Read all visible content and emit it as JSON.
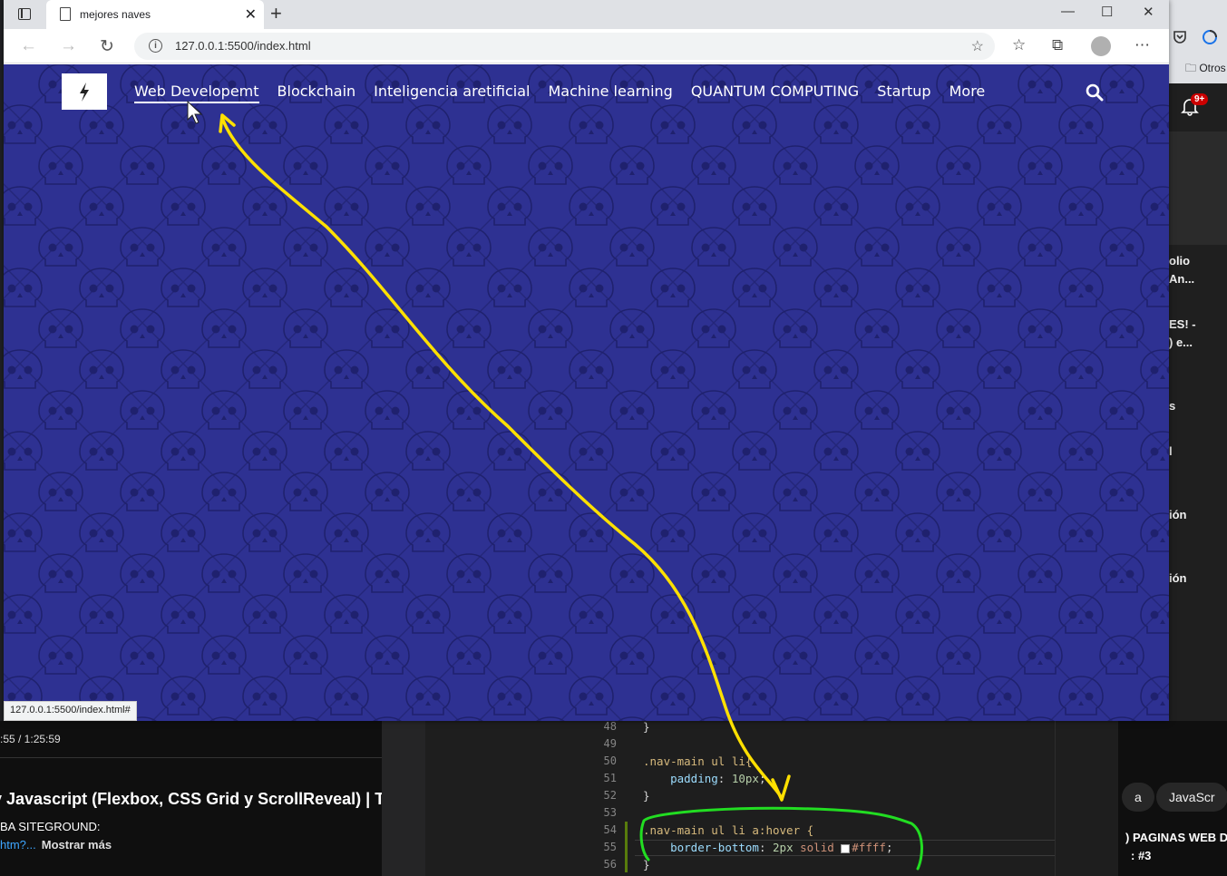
{
  "browser": {
    "tab_title": "mejores naves",
    "url": "127.0.0.1:5500/index.html",
    "status_url": "127.0.0.1:5500/index.html#"
  },
  "site": {
    "nav": [
      {
        "label": "Web Developemt",
        "active": true
      },
      {
        "label": "Blockchain"
      },
      {
        "label": "Inteligencia aretificial"
      },
      {
        "label": "Machine learning"
      },
      {
        "label": "QUANTUM COMPUTING"
      },
      {
        "label": "Startup"
      },
      {
        "label": "More"
      }
    ],
    "background": "#2e3192",
    "accent": "#ffffff"
  },
  "editor": {
    "lines": [
      {
        "num": "48",
        "text": "}"
      },
      {
        "num": "49",
        "text": ""
      },
      {
        "num": "50",
        "selector": ".nav-main ul li{"
      },
      {
        "num": "51",
        "prop": "padding",
        "value": "10px"
      },
      {
        "num": "52",
        "text": "}"
      },
      {
        "num": "53",
        "text": ""
      },
      {
        "num": "54",
        "selector": ".nav-main ul li a:hover {"
      },
      {
        "num": "55",
        "prop": "border-bottom",
        "value_num": "2px",
        "value_kw": "solid",
        "value_color": "#ffff"
      },
      {
        "num": "56",
        "text": "}"
      }
    ]
  },
  "youtube": {
    "time": ":55 / 1:25:59",
    "title": "y Javascript (Flexbox, CSS Grid y ScrollReveal) | Tec",
    "sub": "BA SITEGROUND:",
    "link": "htm?...",
    "more": "Mostrar más",
    "chips": [
      "a",
      "JavaScr"
    ],
    "right_title": ") PAGINAS WEB D",
    "right_sub": ": #3",
    "bookmarks": "Otros",
    "badge": "9+",
    "side_texts": [
      "olio",
      "An...",
      "ES! -",
      ") e...",
      "s",
      "l",
      "ión",
      "ión"
    ]
  },
  "annotations": {
    "arrow_color": "#ffe000",
    "circle_color": "#22dd22"
  }
}
